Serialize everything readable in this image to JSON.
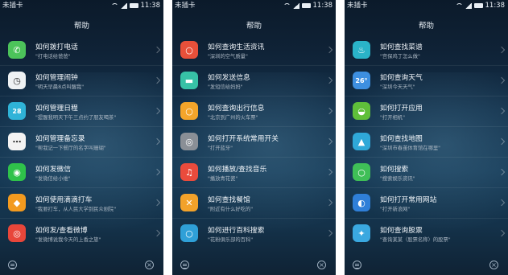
{
  "phones": [
    {
      "status": {
        "carrier": "未插卡",
        "time": "11:38"
      },
      "title": "帮助",
      "items": [
        {
          "title": "如何拨打电话",
          "subtitle": "\"打电话给爸爸\"",
          "icon": "phone-icon",
          "color": "#4cc35a",
          "glyph": "✆"
        },
        {
          "title": "如何管理闹钟",
          "subtitle": "\"明天早晨8点叫醒我\"",
          "icon": "alarm-clock-icon",
          "color": "#eef2f4",
          "glyph": "◷"
        },
        {
          "title": "如何管理日程",
          "subtitle": "\"提醒我明天下午三点约了朋友喝茶\"",
          "icon": "calendar-icon",
          "color": "#2fb3d8",
          "glyph": "28"
        },
        {
          "title": "如何管理备忘录",
          "subtitle": "\"帮我记一下餐厅的名字叫珊瑚\"",
          "icon": "memo-icon",
          "color": "#f3f3f3",
          "glyph": "⋯"
        },
        {
          "title": "如何发微信",
          "subtitle": "\"发微信给小维\"",
          "icon": "wechat-icon",
          "color": "#2fc24a",
          "glyph": "◉"
        },
        {
          "title": "如何使用滴滴打车",
          "subtitle": "\"我要打车，从人民大学到民众剧院\"",
          "icon": "didi-taxi-icon",
          "color": "#f29a1f",
          "glyph": "◆"
        },
        {
          "title": "如何发/查看微博",
          "subtitle": "\"发微博说我今天的上香之旅\"",
          "icon": "weibo-icon",
          "color": "#e8463a",
          "glyph": "◎"
        }
      ]
    },
    {
      "status": {
        "carrier": "未插卡",
        "time": "11:38"
      },
      "title": "帮助",
      "items": [
        {
          "title": "如何查询生活资讯",
          "subtitle": "\"深圳的空气质量\"",
          "icon": "search-life-icon",
          "color": "#e8503a",
          "glyph": "○"
        },
        {
          "title": "如何发送信息",
          "subtitle": "\"发短信给妈妈\"",
          "icon": "message-icon",
          "color": "#37c1a6",
          "glyph": "▬"
        },
        {
          "title": "如何查询出行信息",
          "subtitle": "\"北京到广州的火车票\"",
          "icon": "travel-search-icon",
          "color": "#f4a52a",
          "glyph": "○"
        },
        {
          "title": "如何打开系统常用开关",
          "subtitle": "\"打开蓝牙\"",
          "icon": "settings-toggle-icon",
          "color": "#8a8f96",
          "glyph": "◎"
        },
        {
          "title": "如何播放/查找音乐",
          "subtitle": "\"播放青花瓷\"",
          "icon": "music-icon",
          "color": "#ea4b3c",
          "glyph": "♫"
        },
        {
          "title": "如何查找餐馆",
          "subtitle": "\"附近有什么好吃的\"",
          "icon": "restaurant-icon",
          "color": "#f2a22a",
          "glyph": "✕"
        },
        {
          "title": "如何进行百科搜索",
          "subtitle": "\"花粉俱乐部的百科\"",
          "icon": "encyclopedia-search-icon",
          "color": "#2fa0d8",
          "glyph": "○"
        }
      ]
    },
    {
      "status": {
        "carrier": "未插卡",
        "time": "11:38"
      },
      "title": "帮助",
      "items": [
        {
          "title": "如何查找菜谱",
          "subtitle": "\"宫保鸡丁怎么做\"",
          "icon": "recipe-icon",
          "color": "#2ab3c8",
          "glyph": "♨"
        },
        {
          "title": "如何查询天气",
          "subtitle": "\"深圳今天天气\"",
          "icon": "weather-icon",
          "color": "#3d8fe0",
          "glyph": "26°"
        },
        {
          "title": "如何打开应用",
          "subtitle": "\"打开相机\"",
          "icon": "android-app-icon",
          "color": "#5fbf3a",
          "glyph": "◒"
        },
        {
          "title": "如何查找地图",
          "subtitle": "\"深圳市春茧体育馆在哪里\"",
          "icon": "map-icon",
          "color": "#2fa8d8",
          "glyph": "▲"
        },
        {
          "title": "如何搜索",
          "subtitle": "\"搜索娱乐资讯\"",
          "icon": "search-icon",
          "color": "#3fbf57",
          "glyph": "○"
        },
        {
          "title": "如何打开常用网站",
          "subtitle": "\"打开新浪网\"",
          "icon": "website-icon",
          "color": "#2f7fd8",
          "glyph": "◐"
        },
        {
          "title": "如何查询股票",
          "subtitle": "\"查询某某（股票名称）的股票\"",
          "icon": "stock-icon",
          "color": "#3aa8e0",
          "glyph": "✦"
        }
      ]
    }
  ]
}
